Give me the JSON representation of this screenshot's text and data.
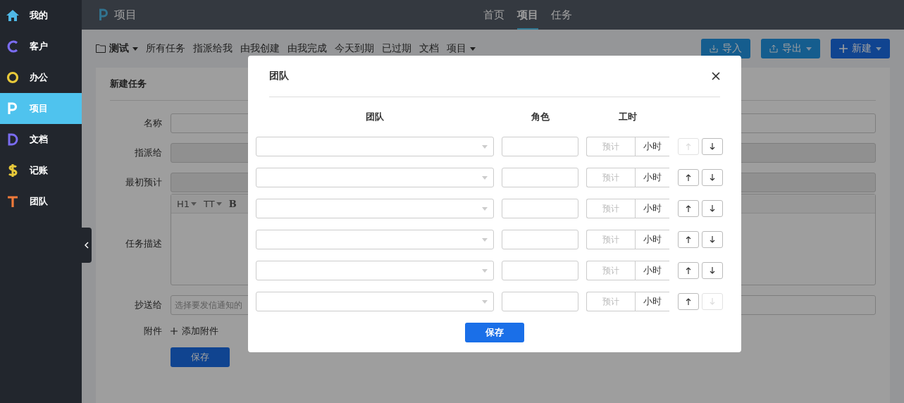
{
  "sidebar": {
    "items": [
      {
        "label": "我的",
        "selected": false
      },
      {
        "label": "客户",
        "selected": false
      },
      {
        "label": "办公",
        "selected": false
      },
      {
        "label": "项目",
        "selected": true
      },
      {
        "label": "文档",
        "selected": false
      },
      {
        "label": "记账",
        "selected": false
      },
      {
        "label": "团队",
        "selected": false
      }
    ]
  },
  "header": {
    "title": "项目",
    "nav": [
      {
        "label": "首页",
        "selected": false
      },
      {
        "label": "项目",
        "selected": true
      },
      {
        "label": "任务",
        "selected": false
      }
    ]
  },
  "toolbar": {
    "menu": "测试",
    "links": [
      "所有任务",
      "指派给我",
      "由我创建",
      "由我完成",
      "今天到期",
      "已过期",
      "文档"
    ],
    "more": "项目",
    "buttons": [
      {
        "label": "导入",
        "kind": "import"
      },
      {
        "label": "导出",
        "kind": "export"
      },
      {
        "label": "新建",
        "kind": "new"
      }
    ]
  },
  "form": {
    "title": "新建任务",
    "name_label": "名称",
    "assign_label": "指派给",
    "estimate_label": "最初预计",
    "desc_label": "任务描述",
    "editor_tools": [
      "H1",
      "TT",
      "B"
    ],
    "cc_label": "抄送给",
    "cc_placeholder": "选择要发信通知的",
    "attach_label": "附件",
    "attach_button": "添加附件",
    "save": "保存"
  },
  "dialog": {
    "title": "团队",
    "columns": [
      "团队",
      "角色",
      "工时"
    ],
    "rows": [
      {
        "hours_placeholder": "预计",
        "unit": "小时",
        "up_disabled": true,
        "down_disabled": false
      },
      {
        "hours_placeholder": "预计",
        "unit": "小时",
        "up_disabled": false,
        "down_disabled": false
      },
      {
        "hours_placeholder": "预计",
        "unit": "小时",
        "up_disabled": false,
        "down_disabled": false
      },
      {
        "hours_placeholder": "预计",
        "unit": "小时",
        "up_disabled": false,
        "down_disabled": false
      },
      {
        "hours_placeholder": "预计",
        "unit": "小时",
        "up_disabled": false,
        "down_disabled": false
      },
      {
        "hours_placeholder": "预计",
        "unit": "小时",
        "up_disabled": false,
        "down_disabled": true
      }
    ],
    "save": "保存"
  }
}
